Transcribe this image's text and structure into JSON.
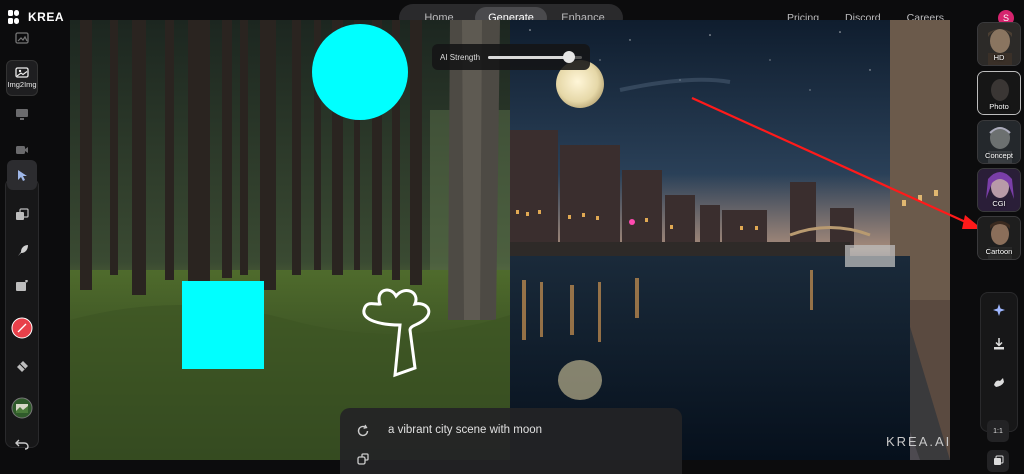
{
  "app": {
    "name": "KREA"
  },
  "nav": {
    "tabs": [
      "Home",
      "Generate",
      "Enhance"
    ],
    "active": "Generate"
  },
  "top_links": [
    "Pricing",
    "Discord",
    "Careers"
  ],
  "user": {
    "avatar_initial": "S",
    "avatar_color": "#d6246e"
  },
  "left_toolbar": {
    "img2img_label": "Img2Img"
  },
  "ai_strength": {
    "label": "AI Strength",
    "value": 0.86
  },
  "prompt": {
    "text": "a vibrant city scene with moon"
  },
  "watermark": "KREA.AI",
  "styles": [
    {
      "label": "HD"
    },
    {
      "label": "Photo"
    },
    {
      "label": "Concept"
    },
    {
      "label": "CGI"
    },
    {
      "label": "Cartoon"
    }
  ],
  "aspect_ratio": "1:1",
  "colors": {
    "shape_fill": "#00ffff",
    "arrow": "#ff1a1a",
    "accent": "#e8404a"
  }
}
